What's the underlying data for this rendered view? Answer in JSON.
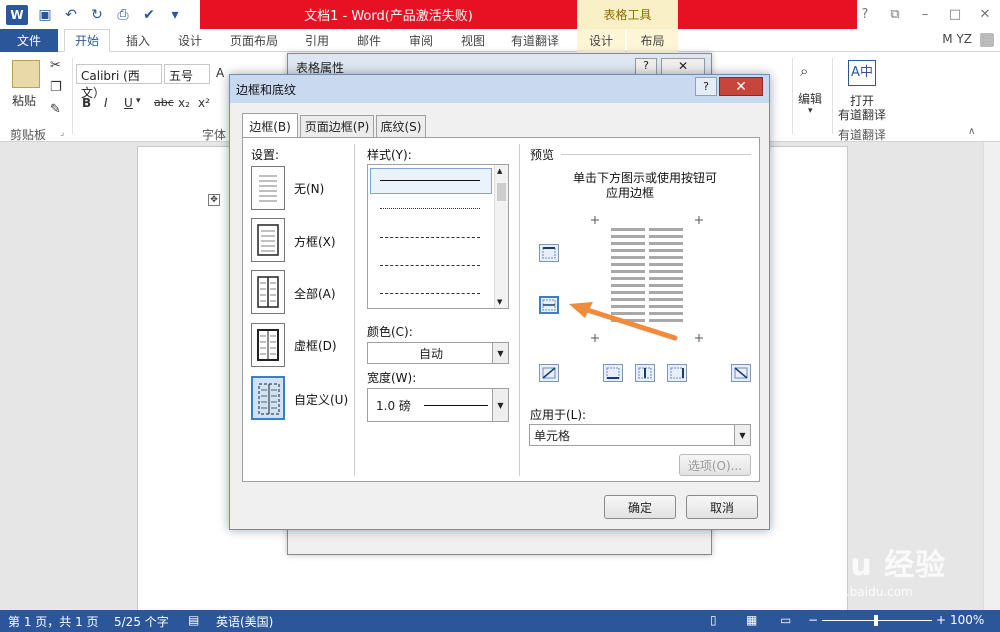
{
  "window": {
    "title": "文档1 - Word(产品激活失败)",
    "contextual_tab_group": "表格工具",
    "help": "?",
    "minimize": "–",
    "restore": "□",
    "close": "✕",
    "user": "M YZ"
  },
  "tabs": [
    "文件",
    "开始",
    "插入",
    "设计",
    "页面布局",
    "引用",
    "邮件",
    "审阅",
    "视图",
    "有道翻译",
    "设计",
    "布局"
  ],
  "ribbon": {
    "paste_label": "粘贴",
    "clipboard_group": "剪贴板",
    "font_name": "Calibri (西文）",
    "font_size": "五号",
    "font_group": "字体",
    "bold": "B",
    "italic": "I",
    "underline": "U",
    "strike": "abc",
    "subscript": "x₂",
    "superscript": "x²",
    "editing_label": "编辑",
    "youdao_label": "打开\n有道翻译",
    "youdao_label_1": "打开",
    "youdao_label_2": "有道翻译",
    "youdao_group": "有道翻译"
  },
  "bg_dialog": {
    "title": "表格属性"
  },
  "dialog": {
    "title": "边框和底纹",
    "help": "?",
    "close": "✕",
    "tabs": [
      "边框(B)",
      "页面边框(P)",
      "底纹(S)"
    ],
    "settings_label": "设置:",
    "settings": [
      "无(N)",
      "方框(X)",
      "全部(A)",
      "虚框(D)",
      "自定义(U)"
    ],
    "style_label": "样式(Y):",
    "color_label": "颜色(C):",
    "color_value": "自动",
    "width_label": "宽度(W):",
    "width_value": "1.0 磅",
    "preview_label": "预览",
    "preview_hint_1": "单击下方图示或使用按钮可",
    "preview_hint_2": "应用边框",
    "apply_to_label": "应用于(L):",
    "apply_to_value": "单元格",
    "options_button": "选项(O)...",
    "ok": "确定",
    "cancel": "取消"
  },
  "status": {
    "page": "第 1 页，共 1 页",
    "words": "5/25 个字",
    "language": "英语(美国)",
    "zoom": "100%"
  },
  "watermark": {
    "brand": "Bai du 经验",
    "url": "jingyan.baidu.com"
  },
  "colors": {
    "accent": "#2b579a",
    "title_red": "#e81123",
    "arrow": "#f08a3c"
  }
}
